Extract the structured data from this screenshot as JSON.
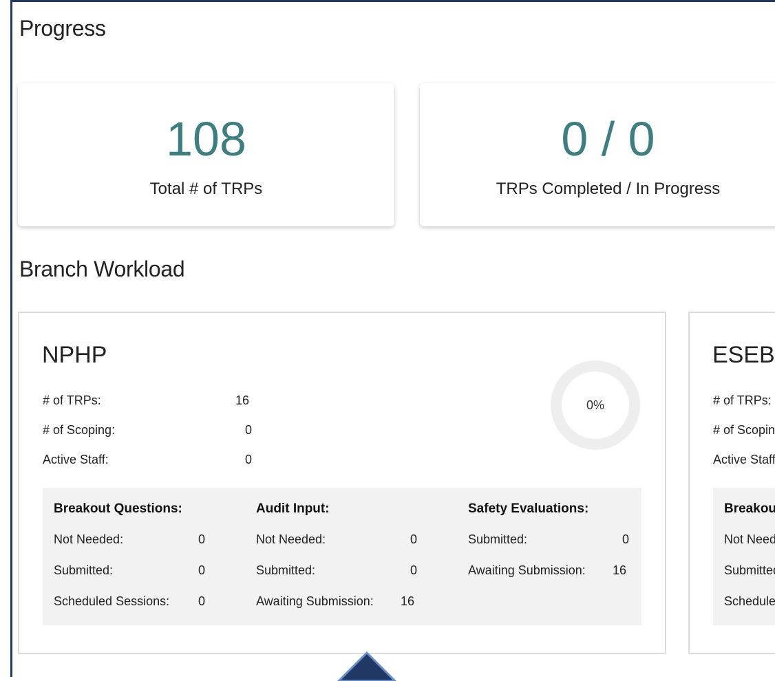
{
  "progress": {
    "title": "Progress",
    "total_value": "108",
    "total_label": "Total # of TRPs",
    "completed_value": "0 / 0",
    "completed_label": "TRPs Completed / In Progress"
  },
  "workload": {
    "title": "Branch Workload",
    "branches": [
      {
        "name": "NPHP",
        "trps_label": "# of TRPs:",
        "trps_value": "16",
        "scoping_label": "# of Scoping:",
        "scoping_value": "0",
        "staff_label": "Active Staff:",
        "staff_value": "0",
        "percent": "0%",
        "progress_fraction": 0,
        "breakout": {
          "title": "Breakout Questions:",
          "not_needed_label": "Not Needed:",
          "not_needed_value": "0",
          "submitted_label": "Submitted:",
          "submitted_value": "0",
          "sessions_label": "Scheduled Sessions:",
          "sessions_value": "0"
        },
        "audit": {
          "title": "Audit Input:",
          "not_needed_label": "Not Needed:",
          "not_needed_value": "0",
          "submitted_label": "Submitted:",
          "submitted_value": "0",
          "awaiting_label": "Awaiting Submission:",
          "awaiting_value": "16"
        },
        "safety": {
          "title": "Safety Evaluations:",
          "submitted_label": "Submitted:",
          "submitted_value": "0",
          "awaiting_label": "Awaiting Submission:",
          "awaiting_value": "16"
        }
      },
      {
        "name": "ESEB",
        "trps_label": "# of TRPs:",
        "scoping_label": "# of Scoping:",
        "staff_label": "Active Staff:",
        "breakout_title": "Breakout Questions:",
        "not_needed_label": "Not Needed:",
        "submitted_label": "Submitted:",
        "sessions_label": "Scheduled Sessions:"
      }
    ]
  },
  "colors": {
    "accent": "#3d7f80",
    "frame": "#1f3864",
    "donut_track": "#eeeeee"
  },
  "icons": {
    "nav_arrow": "chevron-up-icon"
  }
}
